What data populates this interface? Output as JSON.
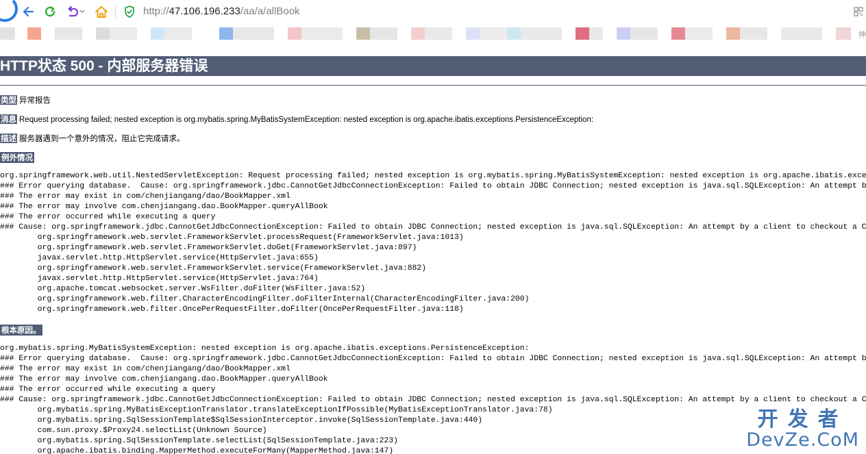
{
  "browser": {
    "url_prefix": "http://",
    "url_host": "47.106.196.233",
    "url_path": "/aa/a/allBook",
    "colors": {
      "back": "#2a7be4",
      "refresh": "#1eae2b",
      "undo": "#7b3fd6",
      "home": "#f2a20c",
      "shield": "#2fa64e"
    },
    "bookmarks_end_text": "抻"
  },
  "page": {
    "title": "HTTP状态 500 - 内部服务器错误",
    "type_label": "类型",
    "type_value": "异常报告",
    "message_label": "消息",
    "message_value": "Request processing failed; nested exception is org.mybatis.spring.MyBatisSystemException: nested exception is org.apache.ibatis.exceptions.PersistenceException:",
    "description_label": "描述",
    "description_value": "服务器遇到一个意外的情况，阻止它完成请求。",
    "exception_heading": "例外情况",
    "exception_trace": [
      "org.springframework.web.util.NestedServletException: Request processing failed; nested exception is org.mybatis.spring.MyBatisSystemException: nested exception is org.apache.ibatis.exceptions.Per",
      "### Error querying database.  Cause: org.springframework.jdbc.CannotGetJdbcConnectionException: Failed to obtain JDBC Connection; nested exception is java.sql.SQLException: An attempt by a client",
      "### The error may exist in com/chenjiangang/dao/BookMapper.xml",
      "### The error may involve com.chenjiangang.dao.BookMapper.queryAllBook",
      "### The error occurred while executing a query",
      "### Cause: org.springframework.jdbc.CannotGetJdbcConnectionException: Failed to obtain JDBC Connection; nested exception is java.sql.SQLException: An attempt by a client to checkout a Connection",
      "\torg.springframework.web.servlet.FrameworkServlet.processRequest(FrameworkServlet.java:1013)",
      "\torg.springframework.web.servlet.FrameworkServlet.doGet(FrameworkServlet.java:897)",
      "\tjavax.servlet.http.HttpServlet.service(HttpServlet.java:655)",
      "\torg.springframework.web.servlet.FrameworkServlet.service(FrameworkServlet.java:882)",
      "\tjavax.servlet.http.HttpServlet.service(HttpServlet.java:764)",
      "\torg.apache.tomcat.websocket.server.WsFilter.doFilter(WsFilter.java:52)",
      "\torg.springframework.web.filter.CharacterEncodingFilter.doFilterInternal(CharacterEncodingFilter.java:200)",
      "\torg.springframework.web.filter.OncePerRequestFilter.doFilter(OncePerRequestFilter.java:118)"
    ],
    "root_cause_heading": "根本原因。",
    "root_cause_trace": [
      "org.mybatis.spring.MyBatisSystemException: nested exception is org.apache.ibatis.exceptions.PersistenceException:",
      "### Error querying database.  Cause: org.springframework.jdbc.CannotGetJdbcConnectionException: Failed to obtain JDBC Connection; nested exception is java.sql.SQLException: An attempt by a client",
      "### The error may exist in com/chenjiangang/dao/BookMapper.xml",
      "### The error may involve com.chenjiangang.dao.BookMapper.queryAllBook",
      "### The error occurred while executing a query",
      "### Cause: org.springframework.jdbc.CannotGetJdbcConnectionException: Failed to obtain JDBC Connection; nested exception is java.sql.SQLException: An attempt by a client to checkout a Connection",
      "\torg.mybatis.spring.MyBatisExceptionTranslator.translateExceptionIfPossible(MyBatisExceptionTranslator.java:78)",
      "\torg.mybatis.spring.SqlSessionTemplate$SqlSessionInterceptor.invoke(SqlSessionTemplate.java:440)",
      "\tcom.sun.proxy.$Proxy24.selectList(Unknown Source)",
      "\torg.mybatis.spring.SqlSessionTemplate.selectList(SqlSessionTemplate.java:223)",
      "\torg.apache.ibatis.binding.MapperMethod.executeForMany(MapperMethod.java:147)"
    ],
    "header_color": "#525d76"
  },
  "watermark": {
    "line1": "开发者",
    "line2": "DevZe.CoM"
  }
}
